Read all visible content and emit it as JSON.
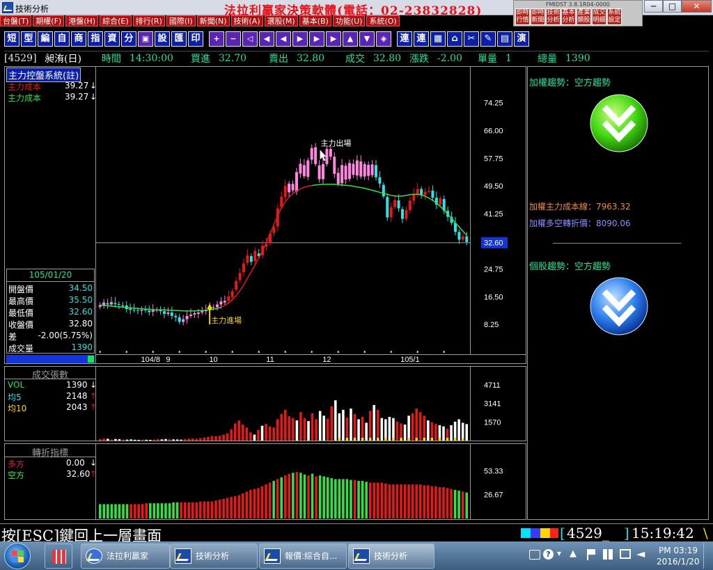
{
  "window": {
    "title": "技術分析",
    "banner": "法拉利贏家決策軟體(電話：02-23832828)",
    "mini_version": "FMIDST 3.8.1R04-0000",
    "mini_buttons": [
      "即時行情",
      "即時新聞",
      "技術分析",
      "基本分析",
      "產業類股",
      "成交明細",
      "系統設定"
    ],
    "min_label": "─",
    "max_label": "□",
    "close_label": "✕"
  },
  "menu": [
    "台盤(T)",
    "期權(F)",
    "港盤(H)",
    "綜合(E)",
    "排行(R)",
    "國際(I)",
    "新聞(N)",
    "技術(A)",
    "選股(M)",
    "基本(B)",
    "功能(U)",
    "系統(O)"
  ],
  "toolbar": {
    "text_buttons": [
      "短",
      "型",
      "編",
      "自",
      "商",
      "指",
      "資",
      "分",
      "▣",
      "設",
      "匯",
      "印"
    ],
    "nav_buttons": [
      "+",
      "−",
      "◁",
      "◀",
      "◀",
      "▶",
      "▶",
      "▶",
      "▲",
      "▼",
      "◈"
    ],
    "right_buttons": [
      "連",
      "連",
      "▦",
      "⌂",
      "✂",
      "✎",
      "▤",
      "演"
    ]
  },
  "quote": {
    "stock": "[4529]",
    "name": "昶洧(日)",
    "time_label": "時間",
    "time": "14:30:00",
    "bid_label": "買進",
    "bid": "32.70",
    "ask_label": "賣出",
    "ask": "32.80",
    "last_label": "成交",
    "last": "32.80",
    "chg_label": "漲跌",
    "chg": "-2.00",
    "lot_label": "單量",
    "lot": "1",
    "vol_label": "總量",
    "vol": "1390"
  },
  "main_panel": {
    "title": "主力控盤系統(註)",
    "cost1_label": "主力成本",
    "cost1": "39.27",
    "cost2_label": "主力成本",
    "cost2": "39.27",
    "arrow": "↓",
    "date": "105/01/20",
    "ohlc": [
      {
        "label": "開盤價",
        "value": "34.50"
      },
      {
        "label": "最高價",
        "value": "35.50"
      },
      {
        "label": "最低價",
        "value": "32.60"
      },
      {
        "label": "收盤價",
        "value": "32.80"
      },
      {
        "label": "差",
        "value": "-2.00(5.75%)"
      },
      {
        "label": "成交量",
        "value": "1390"
      }
    ],
    "annotation_exit": "主力出場",
    "annotation_entry": "主力進場",
    "price_ticks": [
      "74.25",
      "66.00",
      "57.75",
      "49.50",
      "41.25",
      "32.60",
      "24.75",
      "16.50",
      "8.25"
    ],
    "date_ticks": [
      "104/8",
      "9",
      "10",
      "11",
      "12",
      "105/1"
    ]
  },
  "volume_panel": {
    "title": "成交張數",
    "rows": [
      {
        "label": "VOL",
        "value": "1390",
        "arrow": "↓"
      },
      {
        "label": "均5",
        "value": "2148",
        "arrow": "↑"
      },
      {
        "label": "均10",
        "value": "2043",
        "arrow": "↑"
      }
    ],
    "ticks": [
      "4711",
      "3141",
      "1570"
    ]
  },
  "turn_panel": {
    "title": "轉折指標",
    "rows": [
      {
        "label": "多方",
        "value": "0.00",
        "arrow": "↓"
      },
      {
        "label": "空方",
        "value": "32.60",
        "arrow": "↑"
      }
    ],
    "ticks": [
      "53.33",
      "26.67"
    ]
  },
  "right_panel": {
    "weighted_trend": "加權趨勢：空方趨勢",
    "weighted_cost": "加權主力成本線：7963.32",
    "weighted_turn": "加權多空轉折價：8090.06",
    "stock_trend": "個股趨勢：空方趨勢"
  },
  "status": {
    "hint": "按[ESC]鍵回上一層畫面",
    "code": "4529_",
    "clock": "15:19:42"
  },
  "taskbar": {
    "items": [
      "法拉利贏家",
      "技術分析",
      "報價:綜合自...",
      "技術分析"
    ],
    "tray_time": "PM 03:19",
    "tray_date": "2016/1/20"
  },
  "colors": {
    "up": "#e41a1a",
    "down": "#31e0e0",
    "ma_red": "#e41a1a",
    "ma_green": "#34e044",
    "magenta": "#ff86e0",
    "accent": "#26e09a",
    "tick_yellow": "#ffd700"
  },
  "chart_data": {
    "type": "candlestick",
    "ylim": [
      0,
      80
    ],
    "candles": [
      [
        13.5,
        14.0
      ],
      [
        14.0,
        14.8
      ],
      [
        14.6,
        14.2
      ],
      [
        14.2,
        14.9
      ],
      [
        14.6,
        14.3
      ],
      [
        14.3,
        14.1
      ],
      [
        13.8,
        13.9
      ],
      [
        13.9,
        12.8
      ],
      [
        13.0,
        12.6
      ],
      [
        12.6,
        12.5
      ],
      [
        12.5,
        12.3
      ],
      [
        12.3,
        12.6
      ],
      [
        12.6,
        12.4
      ],
      [
        12.4,
        11.9
      ],
      [
        12.0,
        12.5
      ],
      [
        12.5,
        12.6
      ],
      [
        12.6,
        12.2
      ],
      [
        12.2,
        11.4
      ],
      [
        11.4,
        11.8
      ],
      [
        11.8,
        10.8
      ],
      [
        10.8,
        10.4
      ],
      [
        10.4,
        9.0
      ],
      [
        9.0,
        9.8
      ],
      [
        9.8,
        10.8
      ],
      [
        10.8,
        11.2
      ],
      [
        11.2,
        11.6
      ],
      [
        11.4,
        11.8
      ],
      [
        11.8,
        12.2
      ],
      [
        12.2,
        12.6
      ],
      [
        12.6,
        13.0
      ],
      [
        13.2,
        13.4
      ],
      [
        13.4,
        14.2
      ],
      [
        14.2,
        15.1
      ],
      [
        14.8,
        15.3
      ],
      [
        15.3,
        16.6
      ],
      [
        16.4,
        18.2
      ],
      [
        18.6,
        21.2
      ],
      [
        21.5,
        23.6
      ],
      [
        23.8,
        26.4
      ],
      [
        26.6,
        28.8
      ],
      [
        28.6,
        26.9
      ],
      [
        27.1,
        30.2
      ],
      [
        29.4,
        28.6
      ],
      [
        28.8,
        31.7
      ],
      [
        31.5,
        32.2
      ],
      [
        32.4,
        35.3
      ],
      [
        35.5,
        37.2
      ],
      [
        37.4,
        42.8
      ],
      [
        43.2,
        46.3
      ],
      [
        46.2,
        49.5
      ],
      [
        47.6,
        50.2
      ],
      [
        50.1,
        48.2
      ],
      [
        47.8,
        53.6
      ],
      [
        53.2,
        56.1
      ],
      [
        55.7,
        52.4
      ],
      [
        52.2,
        57.1
      ],
      [
        57.3,
        60.8
      ],
      [
        61.0,
        56.0
      ],
      [
        55.6,
        51.5
      ],
      [
        51.5,
        56.0
      ],
      [
        56.0,
        60.5
      ],
      [
        60.5,
        58.2
      ],
      [
        58.2,
        53.1
      ],
      [
        53.4,
        50.1
      ],
      [
        50.3,
        55.7
      ],
      [
        55.5,
        51.4
      ],
      [
        51.6,
        56.3
      ],
      [
        56.1,
        52.8
      ],
      [
        52.6,
        57.1
      ],
      [
        56.8,
        52.3
      ],
      [
        52.3,
        56.0
      ],
      [
        55.8,
        52.5
      ],
      [
        52.7,
        55.9
      ],
      [
        55.7,
        52.1
      ],
      [
        52.1,
        50.2
      ],
      [
        49.8,
        46.4
      ],
      [
        46.2,
        40.1
      ],
      [
        40.1,
        43.2
      ],
      [
        43.2,
        45.3
      ],
      [
        45.2,
        42.8
      ],
      [
        42.6,
        39.7
      ],
      [
        39.7,
        42.3
      ],
      [
        42.3,
        45.1
      ],
      [
        45.1,
        47.2
      ],
      [
        46.8,
        48.6
      ],
      [
        48.6,
        46.7
      ],
      [
        46.7,
        47.8
      ],
      [
        47.8,
        48.1
      ],
      [
        48.1,
        46.0
      ],
      [
        46.0,
        43.9
      ],
      [
        43.9,
        45.8
      ],
      [
        45.6,
        42.1
      ],
      [
        42.1,
        40.3
      ],
      [
        40.3,
        38.5
      ],
      [
        38.5,
        35.8
      ],
      [
        35.8,
        33.5
      ],
      [
        33.5,
        34.5
      ],
      [
        34.5,
        32.8
      ]
    ],
    "ma_slow": [
      14.0,
      13.9,
      13.8,
      13.7,
      13.6,
      13.5,
      13.4,
      13.3,
      13.2,
      13.1,
      13.0,
      12.9,
      12.8,
      12.8,
      12.7,
      12.6,
      12.6,
      12.6,
      12.5,
      12.5,
      12.4,
      12.4,
      12.3,
      12.3,
      12.3,
      12.3,
      12.4,
      12.4,
      12.5,
      12.6,
      12.8,
      13.0,
      13.4,
      13.9,
      14.7,
      15.6,
      16.8,
      18.3,
      20.0,
      22.0,
      24.0,
      26.0,
      28.0,
      30.2,
      32.6,
      35.2,
      38.0,
      40.6,
      43.0,
      44.8,
      46.2,
      47.2,
      48.0,
      48.6,
      49.1,
      49.4,
      49.6,
      49.8,
      49.9,
      50.0,
      50.0,
      50.0,
      50.0,
      49.9,
      49.8,
      49.7,
      49.6,
      49.4,
      49.2,
      49.0,
      48.8,
      48.5,
      48.2,
      47.9,
      47.6,
      47.3,
      47.0,
      46.7,
      46.5,
      46.4,
      46.5,
      46.7,
      46.9,
      47.0,
      47.0,
      46.8,
      46.4,
      45.9,
      45.2,
      44.4,
      43.4,
      42.3,
      41.1,
      39.8,
      38.5,
      37.3,
      36.0,
      34.8
    ],
    "volume": [
      120,
      180,
      150,
      90,
      130,
      110,
      90,
      80,
      100,
      70,
      60,
      80,
      70,
      60,
      90,
      110,
      100,
      130,
      120,
      100,
      90,
      80,
      140,
      160,
      180,
      150,
      200,
      260,
      300,
      380,
      360,
      400,
      500,
      600,
      950,
      1450,
      1700,
      1350,
      1100,
      700,
      500,
      900,
      1250,
      1400,
      1200,
      1100,
      1800,
      2250,
      2600,
      2050,
      1900,
      1700,
      2400,
      1900,
      1650,
      2300,
      1800,
      2500,
      2100,
      1850,
      2900,
      3400,
      2300,
      2600,
      1950,
      2700,
      2250,
      1800,
      2000,
      1500,
      2500,
      3000,
      2600,
      1900,
      1800,
      2000,
      1900,
      1600,
      1450,
      1350,
      2100,
      2300,
      2700,
      2400,
      2100,
      1700,
      1550,
      1400,
      1300,
      1200,
      1000,
      1300,
      1600,
      1800,
      1500,
      1390
    ],
    "volume_ylim": [
      0,
      6000
    ],
    "turn": [
      16,
      16,
      16,
      16,
      16,
      16,
      16,
      16,
      16,
      16,
      16,
      16,
      17,
      17,
      17,
      17,
      17,
      17,
      17,
      18,
      18,
      18,
      18,
      18,
      18,
      18,
      19,
      19,
      19,
      19,
      20,
      21,
      22,
      23,
      24,
      25,
      26,
      28,
      30,
      32,
      33,
      34,
      36,
      38,
      40,
      42,
      44,
      46,
      48,
      50,
      51,
      52,
      51,
      49,
      48,
      50,
      47,
      48,
      47,
      46,
      45,
      44,
      44,
      44,
      44,
      43,
      43,
      42,
      42,
      41,
      40,
      40,
      40,
      40,
      39,
      38,
      38,
      38,
      38,
      38,
      38,
      38,
      38,
      38,
      37,
      37,
      36,
      36,
      35,
      35,
      34,
      33,
      32,
      31,
      30,
      29
    ],
    "turn_ylim": [
      0,
      80
    ],
    "turn_colors": [
      "g",
      "g",
      "g",
      "g",
      "g",
      "g",
      "g",
      "g",
      "r",
      "r",
      "r",
      "r",
      "r",
      "g",
      "g",
      "g",
      "g",
      "g",
      "g",
      "g",
      "g",
      "r",
      "r",
      "r",
      "r",
      "r",
      "r",
      "r",
      "r",
      "r",
      "r",
      "r",
      "r",
      "r",
      "r",
      "r",
      "r",
      "r",
      "r",
      "r",
      "r",
      "r",
      "r",
      "r",
      "r",
      "g",
      "r",
      "g",
      "r",
      "r",
      "g",
      "r",
      "g",
      "g",
      "r",
      "g",
      "r",
      "g",
      "g",
      "g",
      "g",
      "g",
      "g",
      "g",
      "g",
      "g",
      "r",
      "g",
      "g",
      "g",
      "r",
      "r",
      "r",
      "r",
      "r",
      "r",
      "r",
      "r",
      "r",
      "r",
      "r",
      "r",
      "r",
      "r",
      "r",
      "r",
      "r",
      "r",
      "r",
      "r",
      "r",
      "r",
      "g",
      "g",
      "r",
      "g"
    ]
  }
}
